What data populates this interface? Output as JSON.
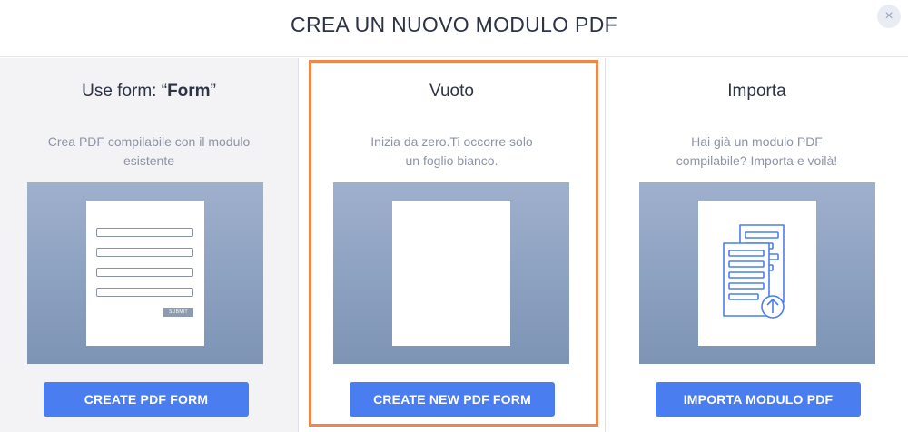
{
  "header": {
    "title": "CREA UN NUOVO MODULO PDF",
    "close_icon": "×"
  },
  "options": [
    {
      "title_prefix": "Use form: “",
      "title_bold": "Form",
      "title_suffix": "”",
      "description": "Crea PDF compilabile con il modulo esistente",
      "preview_submit_label": "SUBMIT",
      "button_label": "CREATE PDF FORM"
    },
    {
      "title": "Vuoto",
      "description_line1": "Inizia da zero.Ti occorre solo",
      "description_line2": "un foglio bianco.",
      "button_label": "CREATE NEW PDF FORM"
    },
    {
      "title": "Importa",
      "description_line1": "Hai già un modulo PDF",
      "description_line2": "compilabile? Importa e voilà!",
      "button_label": "IMPORTA MODULO PDF"
    }
  ],
  "colors": {
    "accent": "#4a7ef0",
    "selection": "#f08748",
    "preview_top": "#9fb0cd",
    "preview_bottom": "#7d94b5"
  },
  "icons": {
    "close": "close-icon",
    "import": "document-upload-icon"
  }
}
